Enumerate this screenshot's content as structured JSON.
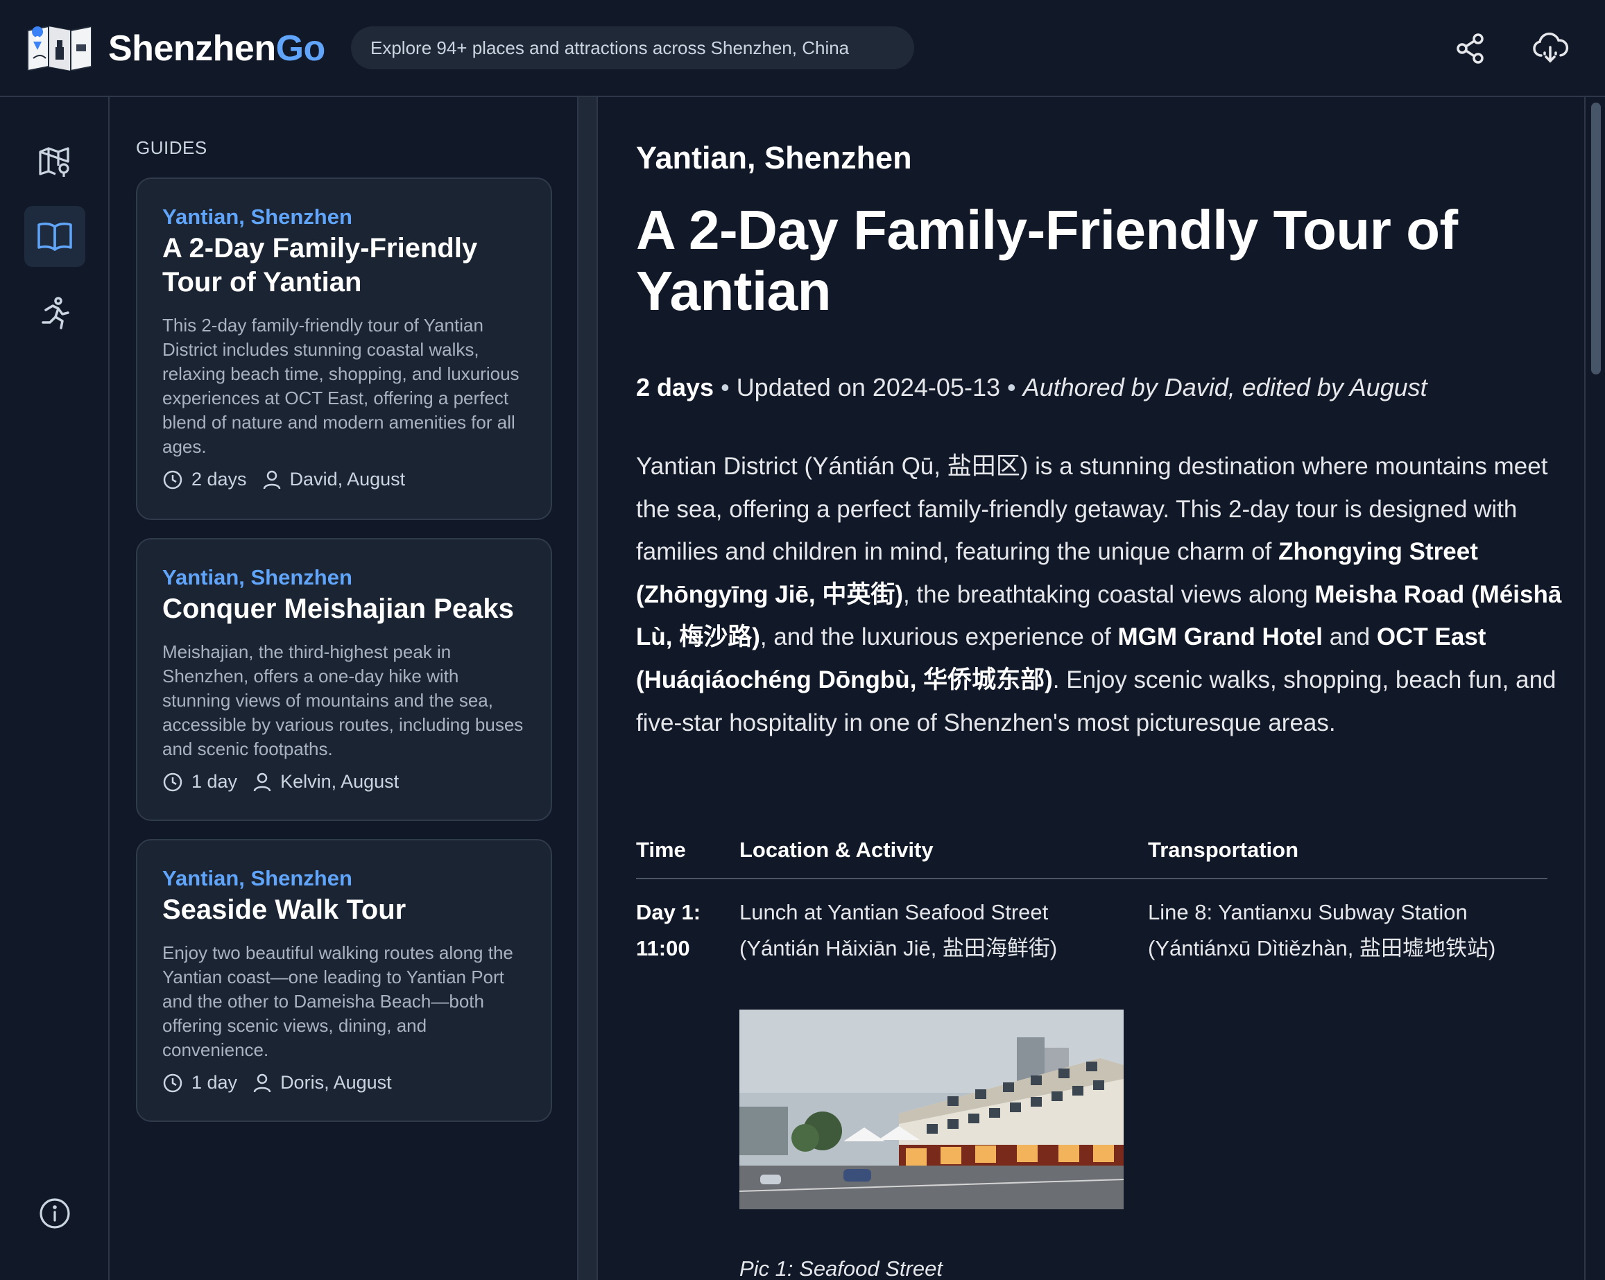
{
  "header": {
    "brand_main": "Shenzhen",
    "brand_accent": "Go",
    "tagline": "Explore 94+ places and attractions across Shenzhen, China",
    "share_icon": "share-icon",
    "cloud_icon": "cloud-download-icon"
  },
  "rail": {
    "items": [
      {
        "icon": "map-pin-icon",
        "active": false
      },
      {
        "icon": "book-open-icon",
        "active": true
      },
      {
        "icon": "running-person-icon",
        "active": false
      }
    ],
    "bottom_icon": "info-icon"
  },
  "guides": {
    "heading": "GUIDES",
    "cards": [
      {
        "region": "Yantian, Shenzhen",
        "title": "A 2-Day Family-Friendly Tour of Yantian",
        "description": "This 2-day family-friendly tour of Yantian District includes stunning coastal walks, relaxing beach time, shopping, and luxurious experiences at OCT East, offering a perfect blend of nature and modern amenities for all ages.",
        "duration": "2 days",
        "authors": "David, August"
      },
      {
        "region": "Yantian, Shenzhen",
        "title": "Conquer Meishajian Peaks",
        "description": "Meishajian, the third-highest peak in Shenzhen, offers a one-day hike with stunning views of mountains and the sea, accessible by various routes, including buses and scenic footpaths.",
        "duration": "1 day",
        "authors": "Kelvin, August"
      },
      {
        "region": "Yantian, Shenzhen",
        "title": "Seaside Walk Tour",
        "description": "Enjoy two beautiful walking routes along the Yantian coast—one leading to Yantian Port and the other to Dameisha Beach—both offering scenic views, dining, and convenience.",
        "duration": "1 day",
        "authors": "Doris, August"
      }
    ]
  },
  "article": {
    "region": "Yantian, Shenzhen",
    "title": "A 2-Day Family-Friendly Tour of Yantian",
    "duration": "2 days",
    "updated": "Updated on 2024-05-13",
    "authors": "Authored by David, edited by August",
    "intro": {
      "p1": "Yantian District (Yántián Qū, 盐田区) is a stunning destination where mountains meet the sea, offering a perfect family-friendly getaway. This 2-day tour is designed with families and children in mind, featuring the unique charm of ",
      "b1": "Zhongying Street (Zhōngyīng Jiē, 中英街)",
      "p2": ", the breathtaking coastal views along ",
      "b2": "Meisha Road (Méishā Lù, 梅沙路)",
      "p3": ", and the luxurious experience of ",
      "b3": "MGM Grand Hotel",
      "p4": " and ",
      "b4": "OCT East (Huáqiáochéng Dōngbù, 华侨城东部)",
      "p5": ". Enjoy scenic walks, shopping, beach fun, and five-star hospitality in one of Shenzhen's most picturesque areas."
    },
    "table": {
      "headers": [
        "Time",
        "Location & Activity",
        "Transportation"
      ],
      "rows": [
        {
          "time": "Day 1: 11:00",
          "location": "Lunch at Yantian Seafood Street (Yántián Hǎixiān Jiē, 盐田海鲜街)",
          "transport": "Line 8: Yantianxu Subway Station (Yántiánxū Dìtiězhàn, 盐田墟地铁站)"
        }
      ]
    },
    "photo_caption": "Pic 1: Seafood Street"
  }
}
